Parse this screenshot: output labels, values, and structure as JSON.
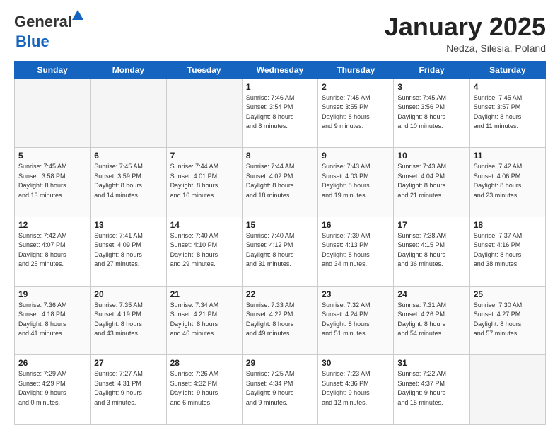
{
  "header": {
    "logo_general": "General",
    "logo_blue": "Blue",
    "month_title": "January 2025",
    "location": "Nedza, Silesia, Poland"
  },
  "days_of_week": [
    "Sunday",
    "Monday",
    "Tuesday",
    "Wednesday",
    "Thursday",
    "Friday",
    "Saturday"
  ],
  "weeks": [
    {
      "days": [
        {
          "num": "",
          "empty": true
        },
        {
          "num": "",
          "empty": true
        },
        {
          "num": "",
          "empty": true
        },
        {
          "num": "1",
          "sunrise": "7:46 AM",
          "sunset": "3:54 PM",
          "daylight": "8 hours and 8 minutes."
        },
        {
          "num": "2",
          "sunrise": "7:45 AM",
          "sunset": "3:55 PM",
          "daylight": "8 hours and 9 minutes."
        },
        {
          "num": "3",
          "sunrise": "7:45 AM",
          "sunset": "3:56 PM",
          "daylight": "8 hours and 10 minutes."
        },
        {
          "num": "4",
          "sunrise": "7:45 AM",
          "sunset": "3:57 PM",
          "daylight": "8 hours and 11 minutes."
        }
      ]
    },
    {
      "days": [
        {
          "num": "5",
          "sunrise": "7:45 AM",
          "sunset": "3:58 PM",
          "daylight": "8 hours and 13 minutes."
        },
        {
          "num": "6",
          "sunrise": "7:45 AM",
          "sunset": "3:59 PM",
          "daylight": "8 hours and 14 minutes."
        },
        {
          "num": "7",
          "sunrise": "7:44 AM",
          "sunset": "4:01 PM",
          "daylight": "8 hours and 16 minutes."
        },
        {
          "num": "8",
          "sunrise": "7:44 AM",
          "sunset": "4:02 PM",
          "daylight": "8 hours and 18 minutes."
        },
        {
          "num": "9",
          "sunrise": "7:43 AM",
          "sunset": "4:03 PM",
          "daylight": "8 hours and 19 minutes."
        },
        {
          "num": "10",
          "sunrise": "7:43 AM",
          "sunset": "4:04 PM",
          "daylight": "8 hours and 21 minutes."
        },
        {
          "num": "11",
          "sunrise": "7:42 AM",
          "sunset": "4:06 PM",
          "daylight": "8 hours and 23 minutes."
        }
      ]
    },
    {
      "days": [
        {
          "num": "12",
          "sunrise": "7:42 AM",
          "sunset": "4:07 PM",
          "daylight": "8 hours and 25 minutes."
        },
        {
          "num": "13",
          "sunrise": "7:41 AM",
          "sunset": "4:09 PM",
          "daylight": "8 hours and 27 minutes."
        },
        {
          "num": "14",
          "sunrise": "7:40 AM",
          "sunset": "4:10 PM",
          "daylight": "8 hours and 29 minutes."
        },
        {
          "num": "15",
          "sunrise": "7:40 AM",
          "sunset": "4:12 PM",
          "daylight": "8 hours and 31 minutes."
        },
        {
          "num": "16",
          "sunrise": "7:39 AM",
          "sunset": "4:13 PM",
          "daylight": "8 hours and 34 minutes."
        },
        {
          "num": "17",
          "sunrise": "7:38 AM",
          "sunset": "4:15 PM",
          "daylight": "8 hours and 36 minutes."
        },
        {
          "num": "18",
          "sunrise": "7:37 AM",
          "sunset": "4:16 PM",
          "daylight": "8 hours and 38 minutes."
        }
      ]
    },
    {
      "days": [
        {
          "num": "19",
          "sunrise": "7:36 AM",
          "sunset": "4:18 PM",
          "daylight": "8 hours and 41 minutes."
        },
        {
          "num": "20",
          "sunrise": "7:35 AM",
          "sunset": "4:19 PM",
          "daylight": "8 hours and 43 minutes."
        },
        {
          "num": "21",
          "sunrise": "7:34 AM",
          "sunset": "4:21 PM",
          "daylight": "8 hours and 46 minutes."
        },
        {
          "num": "22",
          "sunrise": "7:33 AM",
          "sunset": "4:22 PM",
          "daylight": "8 hours and 49 minutes."
        },
        {
          "num": "23",
          "sunrise": "7:32 AM",
          "sunset": "4:24 PM",
          "daylight": "8 hours and 51 minutes."
        },
        {
          "num": "24",
          "sunrise": "7:31 AM",
          "sunset": "4:26 PM",
          "daylight": "8 hours and 54 minutes."
        },
        {
          "num": "25",
          "sunrise": "7:30 AM",
          "sunset": "4:27 PM",
          "daylight": "8 hours and 57 minutes."
        }
      ]
    },
    {
      "days": [
        {
          "num": "26",
          "sunrise": "7:29 AM",
          "sunset": "4:29 PM",
          "daylight": "9 hours and 0 minutes."
        },
        {
          "num": "27",
          "sunrise": "7:27 AM",
          "sunset": "4:31 PM",
          "daylight": "9 hours and 3 minutes."
        },
        {
          "num": "28",
          "sunrise": "7:26 AM",
          "sunset": "4:32 PM",
          "daylight": "9 hours and 6 minutes."
        },
        {
          "num": "29",
          "sunrise": "7:25 AM",
          "sunset": "4:34 PM",
          "daylight": "9 hours and 9 minutes."
        },
        {
          "num": "30",
          "sunrise": "7:23 AM",
          "sunset": "4:36 PM",
          "daylight": "9 hours and 12 minutes."
        },
        {
          "num": "31",
          "sunrise": "7:22 AM",
          "sunset": "4:37 PM",
          "daylight": "9 hours and 15 minutes."
        },
        {
          "num": "",
          "empty": true
        }
      ]
    }
  ],
  "labels": {
    "sunrise": "Sunrise: ",
    "sunset": "Sunset: ",
    "daylight": "Daylight: "
  }
}
